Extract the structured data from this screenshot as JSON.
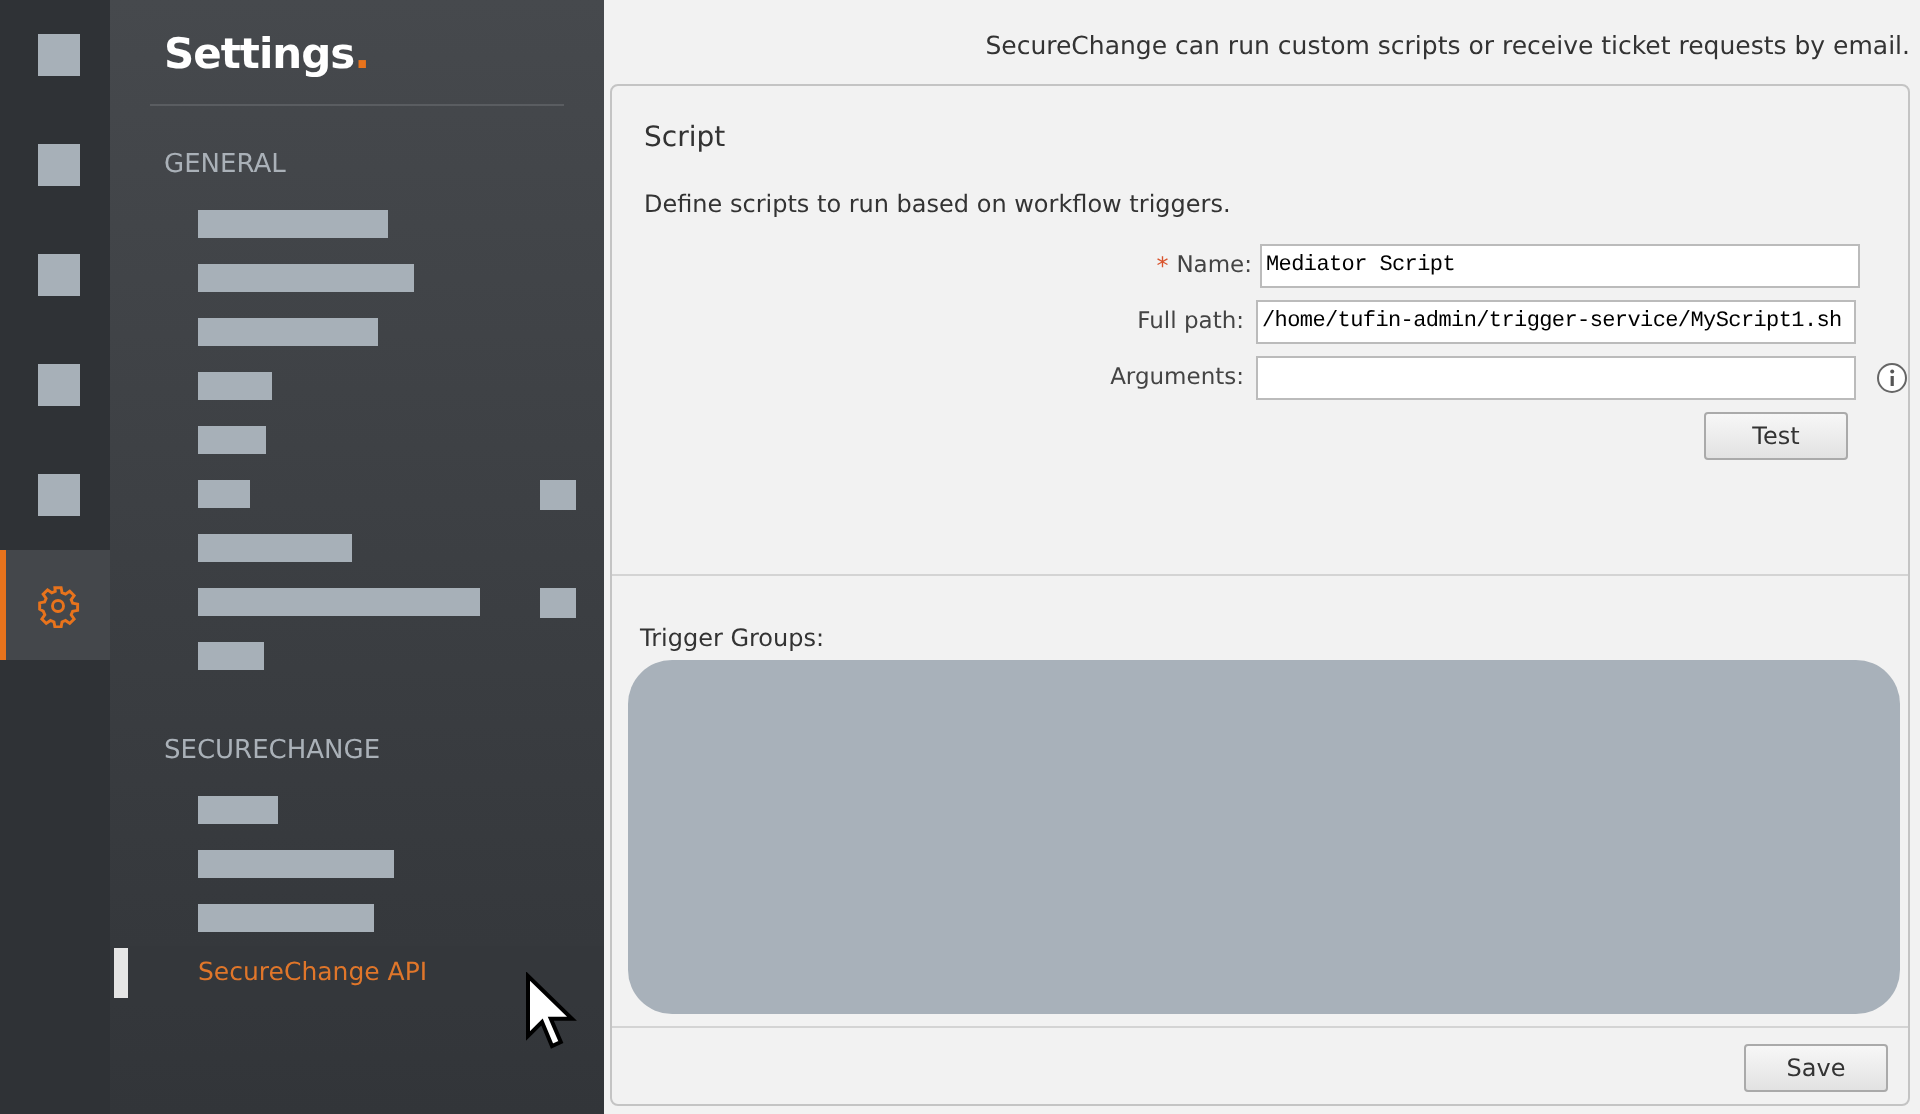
{
  "rail": [
    {
      "kind": "redacted",
      "selected": false
    },
    {
      "kind": "redacted",
      "selected": false
    },
    {
      "kind": "redacted",
      "selected": false
    },
    {
      "kind": "redacted",
      "selected": false
    },
    {
      "kind": "redacted",
      "selected": false
    },
    {
      "kind": "gear",
      "selected": true
    }
  ],
  "nav": {
    "title": "Settings",
    "title_mark": ".",
    "sections": [
      {
        "heading": "GENERAL",
        "items": [
          {
            "kind": "redacted",
            "badge": false
          },
          {
            "kind": "redacted",
            "badge": false
          },
          {
            "kind": "redacted",
            "badge": false
          },
          {
            "kind": "redacted",
            "badge": false
          },
          {
            "kind": "redacted",
            "badge": false
          },
          {
            "kind": "redacted",
            "badge": true
          },
          {
            "kind": "redacted",
            "badge": false
          },
          {
            "kind": "redacted",
            "badge": true
          },
          {
            "kind": "redacted",
            "badge": false
          }
        ]
      },
      {
        "heading": "SECURECHANGE",
        "items": [
          {
            "kind": "redacted",
            "badge": false
          },
          {
            "kind": "redacted",
            "badge": false
          },
          {
            "kind": "redacted",
            "badge": false
          },
          {
            "kind": "link",
            "label": "SecureChange API",
            "selected": true,
            "badge": false
          }
        ]
      }
    ]
  },
  "header_note": "SecureChange can run custom scripts or receive ticket requests by email.",
  "script_panel": {
    "title": "Script",
    "description": "Define scripts to run based on workflow triggers.",
    "fields": [
      {
        "label": "Name:",
        "required_mark": "*",
        "value": "Mediator Script",
        "info": false
      },
      {
        "label": "Full path:",
        "value": "/home/tufin-admin/trigger-service/MyScript1.sh",
        "info": false
      },
      {
        "label": "Arguments:",
        "info": true
      }
    ],
    "test_button": "Test"
  },
  "trigger_groups": {
    "label": "Trigger Groups:"
  },
  "save_button": "Save"
}
